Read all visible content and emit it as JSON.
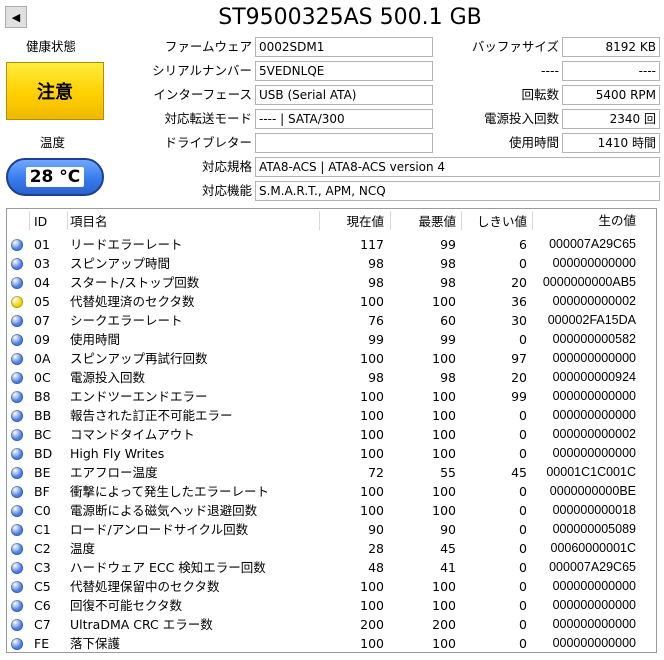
{
  "window": {
    "title": "ST9500325AS 500.1 GB",
    "nav_glyph": "◀"
  },
  "health": {
    "label": "健康状態",
    "status": "注意",
    "status_color": "#ffd800"
  },
  "temperature": {
    "label": "温度",
    "value": "28 °C",
    "badge_color": "#3b7ff0"
  },
  "info_left": [
    {
      "label": "ファームウェア",
      "value": "0002SDM1"
    },
    {
      "label": "シリアルナンバー",
      "value": "5VEDNLQE"
    },
    {
      "label": "インターフェース",
      "value": "USB (Serial ATA)"
    },
    {
      "label": "対応転送モード",
      "value": "---- | SATA/300"
    },
    {
      "label": "ドライブレター",
      "value": ""
    }
  ],
  "info_right": [
    {
      "label": "バッファサイズ",
      "value": "8192 KB"
    },
    {
      "label": "----",
      "value": "----"
    },
    {
      "label": "回転数",
      "value": "5400 RPM"
    },
    {
      "label": "電源投入回数",
      "value": "2340 回"
    },
    {
      "label": "使用時間",
      "value": "1410 時間"
    }
  ],
  "standard": {
    "label": "対応規格",
    "value": "ATA8-ACS | ATA8-ACS version 4"
  },
  "features": {
    "label": "対応機能",
    "value": "S.M.A.R.T., APM, NCQ"
  },
  "smart": {
    "headers": {
      "id": "ID",
      "name": "項目名",
      "current": "現在値",
      "worst": "最悪値",
      "threshold": "しきい値",
      "raw": "生の値"
    },
    "status_colors": {
      "good": "#4a7fe8",
      "caution": "#f2d200"
    },
    "rows": [
      {
        "status": "good",
        "id": "01",
        "name": "リードエラーレート",
        "current": "117",
        "worst": "99",
        "threshold": "6",
        "raw": "000007A29C65"
      },
      {
        "status": "good",
        "id": "03",
        "name": "スピンアップ時間",
        "current": "98",
        "worst": "98",
        "threshold": "0",
        "raw": "000000000000"
      },
      {
        "status": "good",
        "id": "04",
        "name": "スタート/ストップ回数",
        "current": "98",
        "worst": "98",
        "threshold": "20",
        "raw": "0000000000AB5"
      },
      {
        "status": "caution",
        "id": "05",
        "name": "代替処理済のセクタ数",
        "current": "100",
        "worst": "100",
        "threshold": "36",
        "raw": "000000000002"
      },
      {
        "status": "good",
        "id": "07",
        "name": "シークエラーレート",
        "current": "76",
        "worst": "60",
        "threshold": "30",
        "raw": "000002FA15DA"
      },
      {
        "status": "good",
        "id": "09",
        "name": "使用時間",
        "current": "99",
        "worst": "99",
        "threshold": "0",
        "raw": "000000000582"
      },
      {
        "status": "good",
        "id": "0A",
        "name": "スピンアップ再試行回数",
        "current": "100",
        "worst": "100",
        "threshold": "97",
        "raw": "000000000000"
      },
      {
        "status": "good",
        "id": "0C",
        "name": "電源投入回数",
        "current": "98",
        "worst": "98",
        "threshold": "20",
        "raw": "000000000924"
      },
      {
        "status": "good",
        "id": "B8",
        "name": "エンドツーエンドエラー",
        "current": "100",
        "worst": "100",
        "threshold": "99",
        "raw": "000000000000"
      },
      {
        "status": "good",
        "id": "BB",
        "name": "報告された訂正不可能エラー",
        "current": "100",
        "worst": "100",
        "threshold": "0",
        "raw": "000000000000"
      },
      {
        "status": "good",
        "id": "BC",
        "name": "コマンドタイムアウト",
        "current": "100",
        "worst": "100",
        "threshold": "0",
        "raw": "000000000002"
      },
      {
        "status": "good",
        "id": "BD",
        "name": "High Fly Writes",
        "current": "100",
        "worst": "100",
        "threshold": "0",
        "raw": "000000000000"
      },
      {
        "status": "good",
        "id": "BE",
        "name": "エアフロー温度",
        "current": "72",
        "worst": "55",
        "threshold": "45",
        "raw": "00001C1C001C"
      },
      {
        "status": "good",
        "id": "BF",
        "name": "衝撃によって発生したエラーレート",
        "current": "100",
        "worst": "100",
        "threshold": "0",
        "raw": "0000000000BE"
      },
      {
        "status": "good",
        "id": "C0",
        "name": "電源断による磁気ヘッド退避回数",
        "current": "100",
        "worst": "100",
        "threshold": "0",
        "raw": "000000000018"
      },
      {
        "status": "good",
        "id": "C1",
        "name": "ロード/アンロードサイクル回数",
        "current": "90",
        "worst": "90",
        "threshold": "0",
        "raw": "000000005089"
      },
      {
        "status": "good",
        "id": "C2",
        "name": "温度",
        "current": "28",
        "worst": "45",
        "threshold": "0",
        "raw": "00060000001C"
      },
      {
        "status": "good",
        "id": "C3",
        "name": "ハードウェア ECC 検知エラー回数",
        "current": "48",
        "worst": "41",
        "threshold": "0",
        "raw": "000007A29C65"
      },
      {
        "status": "good",
        "id": "C5",
        "name": "代替処理保留中のセクタ数",
        "current": "100",
        "worst": "100",
        "threshold": "0",
        "raw": "000000000000"
      },
      {
        "status": "good",
        "id": "C6",
        "name": "回復不可能セクタ数",
        "current": "100",
        "worst": "100",
        "threshold": "0",
        "raw": "000000000000"
      },
      {
        "status": "good",
        "id": "C7",
        "name": "UltraDMA CRC エラー数",
        "current": "200",
        "worst": "200",
        "threshold": "0",
        "raw": "000000000000"
      },
      {
        "status": "good",
        "id": "FE",
        "name": "落下保護",
        "current": "100",
        "worst": "100",
        "threshold": "0",
        "raw": "000000000000"
      }
    ]
  }
}
